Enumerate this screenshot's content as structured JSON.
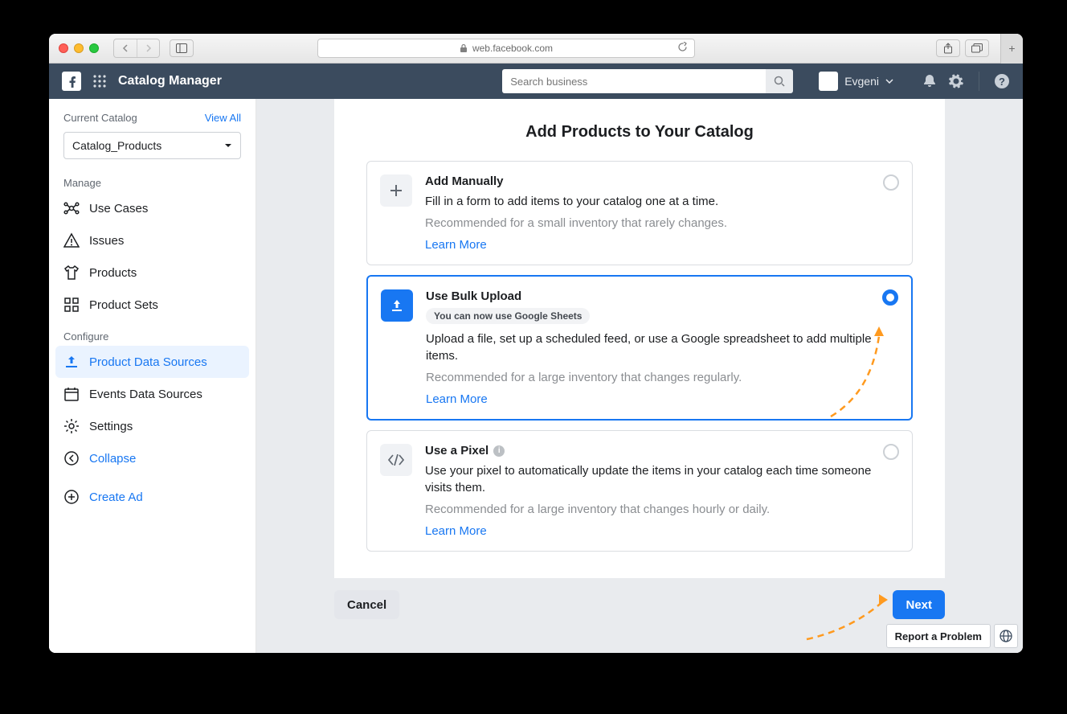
{
  "browser": {
    "url_host": "web.facebook.com"
  },
  "navbar": {
    "app_title": "Catalog Manager",
    "search_placeholder": "Search business",
    "user_name": "Evgeni"
  },
  "sidebar": {
    "current_label": "Current Catalog",
    "view_all": "View All",
    "selected_catalog": "Catalog_Products",
    "manage_label": "Manage",
    "manage_items": [
      {
        "label": "Use Cases"
      },
      {
        "label": "Issues"
      },
      {
        "label": "Products"
      },
      {
        "label": "Product Sets"
      }
    ],
    "configure_label": "Configure",
    "configure_items": [
      {
        "label": "Product Data Sources"
      },
      {
        "label": "Events Data Sources"
      },
      {
        "label": "Settings"
      }
    ],
    "collapse_label": "Collapse",
    "create_ad_label": "Create Ad"
  },
  "main": {
    "heading": "Add Products to Your Catalog",
    "options": [
      {
        "title": "Add Manually",
        "desc": "Fill in a form to add items to your catalog one at a time.",
        "rec": "Recommended for a small inventory that rarely changes.",
        "learn": "Learn More"
      },
      {
        "title": "Use Bulk Upload",
        "badge": "You can now use Google Sheets",
        "desc": "Upload a file, set up a scheduled feed, or use a Google spreadsheet to add multiple items.",
        "rec": "Recommended for a large inventory that changes regularly.",
        "learn": "Learn More"
      },
      {
        "title": "Use a Pixel",
        "desc": "Use your pixel to automatically update the items in your catalog each time someone visits them.",
        "rec": "Recommended for a large inventory that changes hourly or daily.",
        "learn": "Learn More"
      }
    ],
    "cancel": "Cancel",
    "next": "Next"
  },
  "footer": {
    "report": "Report a Problem"
  }
}
